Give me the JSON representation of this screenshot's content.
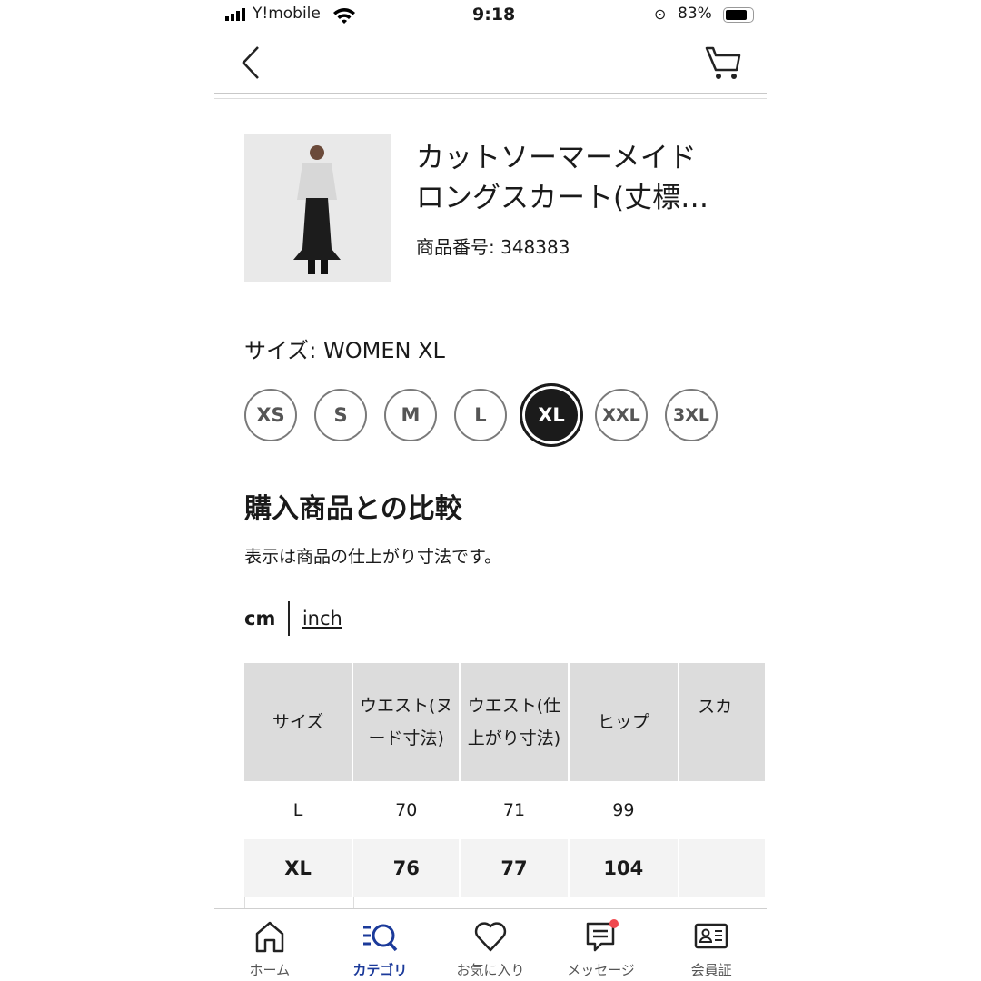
{
  "status_bar": {
    "carrier": "Y!mobile",
    "time": "9:18",
    "battery": "83%"
  },
  "header": {
    "back_icon": "chevron-left-icon",
    "cart_icon": "cart-icon"
  },
  "product": {
    "title_line1": "カットソーマーメイド",
    "title_line2": "ロングスカート(丈標…",
    "id_label": "商品番号:",
    "id_value": "348383"
  },
  "size": {
    "label": "サイズ: WOMEN XL",
    "options": [
      "XS",
      "S",
      "M",
      "L",
      "XL",
      "XXL",
      "3XL"
    ],
    "selected": "XL"
  },
  "compare": {
    "title": "購入商品との比較",
    "note": "表示は商品の仕上がり寸法です。",
    "unit_cm": "cm",
    "unit_inch": "inch"
  },
  "table": {
    "headers": [
      "サイズ",
      "ウエスト(ヌード寸法)",
      "ウエスト(仕上がり寸法)",
      "ヒップ",
      "スカ"
    ],
    "rows": [
      [
        "L",
        "70",
        "71",
        "99",
        ""
      ],
      [
        "XL",
        "76",
        "77",
        "104",
        ""
      ]
    ]
  },
  "nav": {
    "items": [
      {
        "label": "ホーム",
        "icon": "home-icon"
      },
      {
        "label": "カテゴリ",
        "icon": "category-search-icon"
      },
      {
        "label": "お気に入り",
        "icon": "heart-icon"
      },
      {
        "label": "メッセージ",
        "icon": "message-icon"
      },
      {
        "label": "会員証",
        "icon": "member-card-icon"
      }
    ],
    "active": "カテゴリ",
    "badge_color": "#f0484e",
    "accent": "#1b3a9a"
  }
}
